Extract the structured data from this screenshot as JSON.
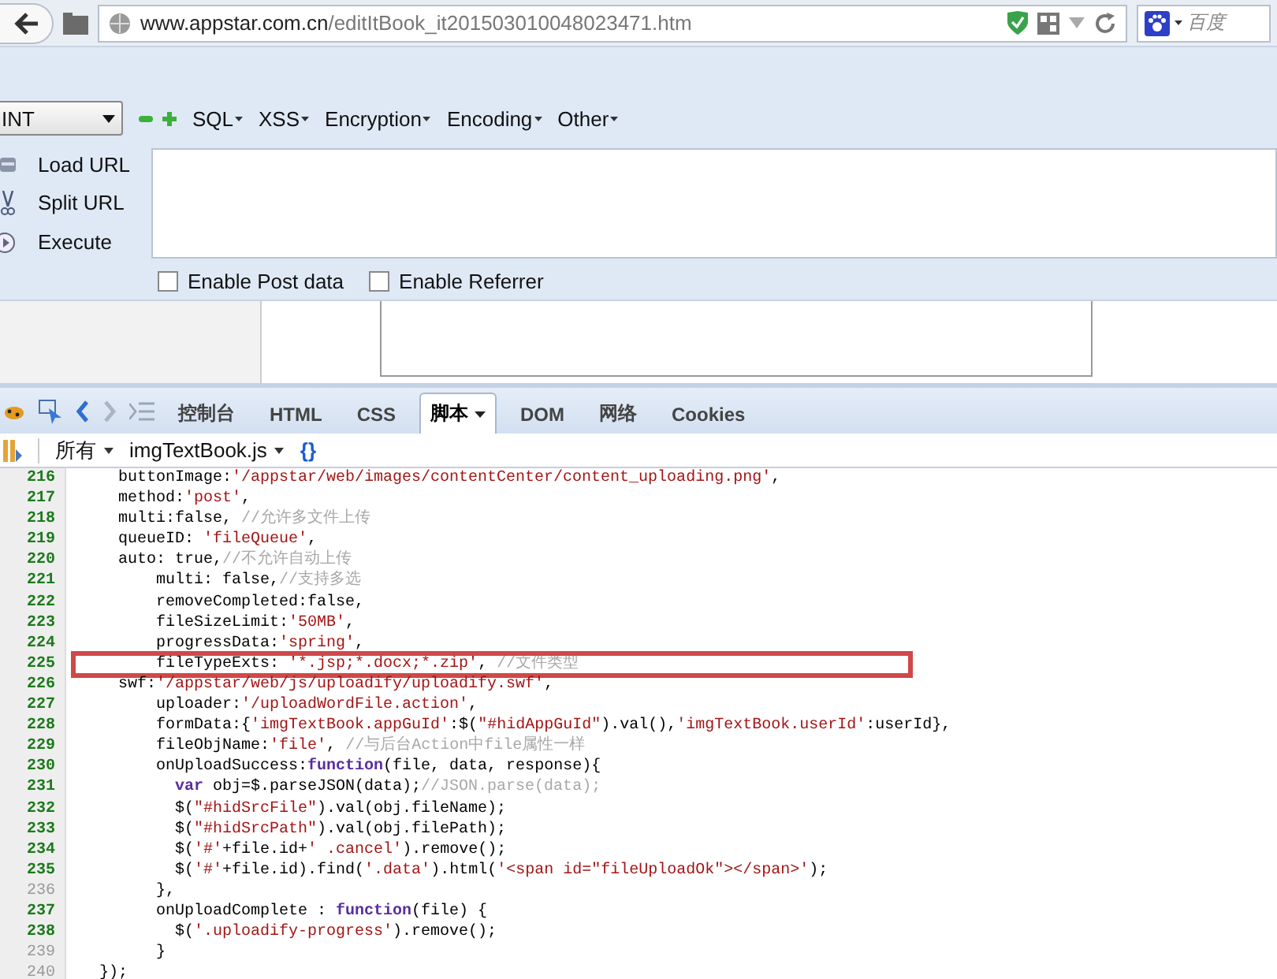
{
  "address_bar": {
    "url_domain": "www.appstar.com.cn",
    "url_path": "/editItBook_it201503010048023471.htm",
    "search_engine": "百度"
  },
  "hackbar": {
    "select_value": "INT",
    "menus": [
      "SQL",
      "XSS",
      "Encryption",
      "Encoding",
      "Other"
    ],
    "actions": [
      {
        "kind": "load",
        "label": "Load URL"
      },
      {
        "kind": "split",
        "label": "Split URL"
      },
      {
        "kind": "execute",
        "label": "Execute"
      }
    ],
    "checkboxes": [
      {
        "label": "Enable Post data",
        "checked": false
      },
      {
        "label": "Enable Referrer",
        "checked": false
      }
    ]
  },
  "firebug": {
    "tabs": [
      {
        "label": "控制台",
        "selected": false,
        "dropdown": false
      },
      {
        "label": "HTML",
        "selected": false,
        "dropdown": false
      },
      {
        "label": "CSS",
        "selected": false,
        "dropdown": false
      },
      {
        "label": "脚本",
        "selected": true,
        "dropdown": true
      },
      {
        "label": "DOM",
        "selected": false,
        "dropdown": false
      },
      {
        "label": "网络",
        "selected": false,
        "dropdown": false
      },
      {
        "label": "Cookies",
        "selected": false,
        "dropdown": false
      }
    ],
    "script_filter": "所有",
    "script_file": "imgTextBook.js",
    "pretty_print": "{}",
    "code_lines": [
      {
        "number": "216",
        "executable": true,
        "highlighted": false,
        "tokens": [
          {
            "kind": "plain",
            "text": "  buttonImage:"
          },
          {
            "kind": "string",
            "text": "'/appstar/web/images/contentCenter/content_uploading.png'"
          },
          {
            "kind": "plain",
            "text": ","
          }
        ]
      },
      {
        "number": "217",
        "executable": true,
        "highlighted": false,
        "tokens": [
          {
            "kind": "plain",
            "text": "  method:"
          },
          {
            "kind": "string",
            "text": "'post'"
          },
          {
            "kind": "plain",
            "text": ","
          }
        ]
      },
      {
        "number": "218",
        "executable": true,
        "highlighted": false,
        "tokens": [
          {
            "kind": "plain",
            "text": "  multi:false, "
          },
          {
            "kind": "comment",
            "text": "//允许多文件上传"
          }
        ]
      },
      {
        "number": "219",
        "executable": true,
        "highlighted": false,
        "tokens": [
          {
            "kind": "plain",
            "text": "  queueID: "
          },
          {
            "kind": "string",
            "text": "'fileQueue'"
          },
          {
            "kind": "plain",
            "text": ","
          }
        ]
      },
      {
        "number": "220",
        "executable": true,
        "highlighted": false,
        "tokens": [
          {
            "kind": "plain",
            "text": "  auto: true,"
          },
          {
            "kind": "comment",
            "text": "//不允许自动上传"
          }
        ]
      },
      {
        "number": "221",
        "executable": true,
        "highlighted": false,
        "tokens": [
          {
            "kind": "plain",
            "text": "      multi: false,"
          },
          {
            "kind": "comment",
            "text": "//支持多选"
          }
        ]
      },
      {
        "number": "222",
        "executable": true,
        "highlighted": false,
        "tokens": [
          {
            "kind": "plain",
            "text": "      removeCompleted:false,"
          }
        ]
      },
      {
        "number": "223",
        "executable": true,
        "highlighted": false,
        "tokens": [
          {
            "kind": "plain",
            "text": "      fileSizeLimit:"
          },
          {
            "kind": "string",
            "text": "'50MB'"
          },
          {
            "kind": "plain",
            "text": ","
          }
        ]
      },
      {
        "number": "224",
        "executable": true,
        "highlighted": false,
        "tokens": [
          {
            "kind": "plain",
            "text": "      progressData:"
          },
          {
            "kind": "string",
            "text": "'spring'"
          },
          {
            "kind": "plain",
            "text": ","
          }
        ]
      },
      {
        "number": "225",
        "executable": true,
        "highlighted": true,
        "tokens": [
          {
            "kind": "plain",
            "text": "      fileTypeExts: "
          },
          {
            "kind": "string",
            "text": "'*.jsp;*.docx;*.zip'"
          },
          {
            "kind": "plain",
            "text": ", "
          },
          {
            "kind": "comment",
            "text": "//文件类型"
          }
        ]
      },
      {
        "number": "226",
        "executable": true,
        "highlighted": false,
        "tokens": [
          {
            "kind": "plain",
            "text": "  swf:"
          },
          {
            "kind": "string",
            "text": "'/appstar/web/js/uploadify/uploadify.swf'"
          },
          {
            "kind": "plain",
            "text": ","
          }
        ]
      },
      {
        "number": "227",
        "executable": true,
        "highlighted": false,
        "tokens": [
          {
            "kind": "plain",
            "text": "      uploader:"
          },
          {
            "kind": "string",
            "text": "'/uploadWordFile.action'"
          },
          {
            "kind": "plain",
            "text": ","
          }
        ]
      },
      {
        "number": "228",
        "executable": true,
        "highlighted": false,
        "tokens": [
          {
            "kind": "plain",
            "text": "      formData:{"
          },
          {
            "kind": "string",
            "text": "'imgTextBook.appGuId'"
          },
          {
            "kind": "plain",
            "text": ":$("
          },
          {
            "kind": "string",
            "text": "\"#hidAppGuId\""
          },
          {
            "kind": "plain",
            "text": ").val(),"
          },
          {
            "kind": "string",
            "text": "'imgTextBook.userId'"
          },
          {
            "kind": "plain",
            "text": ":userId},"
          }
        ]
      },
      {
        "number": "229",
        "executable": true,
        "highlighted": false,
        "tokens": [
          {
            "kind": "plain",
            "text": "      fileObjName:"
          },
          {
            "kind": "string",
            "text": "'file'"
          },
          {
            "kind": "plain",
            "text": ", "
          },
          {
            "kind": "comment",
            "text": "//与后台Action中file属性一样"
          }
        ]
      },
      {
        "number": "230",
        "executable": true,
        "highlighted": false,
        "tokens": [
          {
            "kind": "plain",
            "text": "      onUploadSuccess:"
          },
          {
            "kind": "keyword",
            "text": "function"
          },
          {
            "kind": "plain",
            "text": "(file, data, response){"
          }
        ]
      },
      {
        "number": "231",
        "executable": true,
        "highlighted": false,
        "tokens": [
          {
            "kind": "keyword",
            "text": "        var"
          },
          {
            "kind": "plain",
            "text": " obj=$.parseJSON(data);"
          },
          {
            "kind": "comment",
            "text": "//JSON.parse(data);"
          }
        ]
      },
      {
        "number": "232",
        "executable": true,
        "highlighted": false,
        "tokens": [
          {
            "kind": "plain",
            "text": "        $("
          },
          {
            "kind": "string",
            "text": "\"#hidSrcFile\""
          },
          {
            "kind": "plain",
            "text": ").val(obj.fileName);"
          }
        ]
      },
      {
        "number": "233",
        "executable": true,
        "highlighted": false,
        "tokens": [
          {
            "kind": "plain",
            "text": "        $("
          },
          {
            "kind": "string",
            "text": "\"#hidSrcPath\""
          },
          {
            "kind": "plain",
            "text": ").val(obj.filePath);"
          }
        ]
      },
      {
        "number": "234",
        "executable": true,
        "highlighted": false,
        "tokens": [
          {
            "kind": "plain",
            "text": "        $("
          },
          {
            "kind": "string",
            "text": "'#'"
          },
          {
            "kind": "plain",
            "text": "+file.id+"
          },
          {
            "kind": "string",
            "text": "' .cancel'"
          },
          {
            "kind": "plain",
            "text": ").remove();"
          }
        ]
      },
      {
        "number": "235",
        "executable": true,
        "highlighted": false,
        "tokens": [
          {
            "kind": "plain",
            "text": "        $("
          },
          {
            "kind": "string",
            "text": "'#'"
          },
          {
            "kind": "plain",
            "text": "+file.id).find("
          },
          {
            "kind": "string",
            "text": "'.data'"
          },
          {
            "kind": "plain",
            "text": ").html("
          },
          {
            "kind": "string",
            "text": "'<span id=\"fileUploadOk\"></span>'"
          },
          {
            "kind": "plain",
            "text": ");"
          }
        ]
      },
      {
        "number": "236",
        "executable": false,
        "highlighted": false,
        "tokens": [
          {
            "kind": "plain",
            "text": "      },"
          }
        ]
      },
      {
        "number": "237",
        "executable": true,
        "highlighted": false,
        "tokens": [
          {
            "kind": "plain",
            "text": "      onUploadComplete : "
          },
          {
            "kind": "keyword",
            "text": "function"
          },
          {
            "kind": "plain",
            "text": "(file) {"
          }
        ]
      },
      {
        "number": "238",
        "executable": true,
        "highlighted": false,
        "tokens": [
          {
            "kind": "plain",
            "text": "        $("
          },
          {
            "kind": "string",
            "text": "'.uploadify-progress'"
          },
          {
            "kind": "plain",
            "text": ").remove();"
          }
        ]
      },
      {
        "number": "239",
        "executable": false,
        "highlighted": false,
        "tokens": [
          {
            "kind": "plain",
            "text": "      }"
          }
        ]
      },
      {
        "number": "240",
        "executable": false,
        "highlighted": false,
        "tokens": [
          {
            "kind": "plain",
            "text": "});"
          }
        ]
      }
    ]
  }
}
